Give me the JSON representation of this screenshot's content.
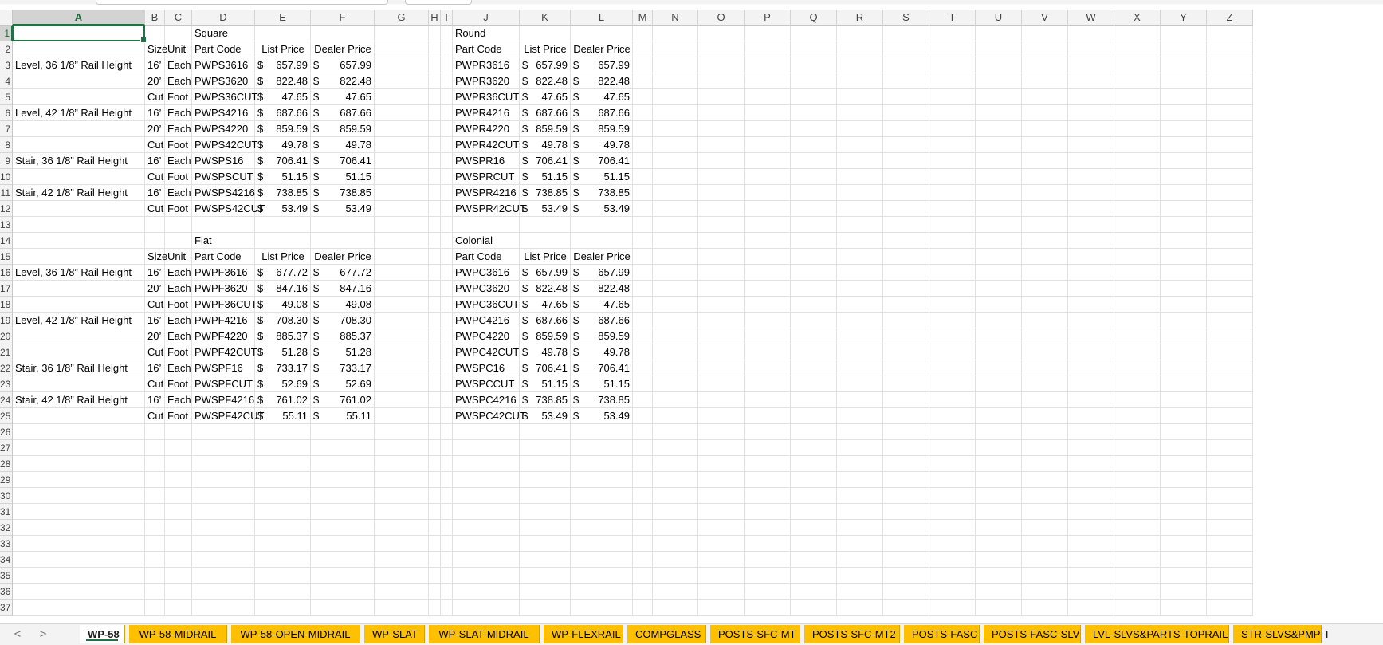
{
  "columns": [
    "A",
    "B",
    "C",
    "D",
    "E",
    "F",
    "G",
    "H",
    "I",
    "J",
    "K",
    "L",
    "M",
    "N",
    "O",
    "P",
    "Q",
    "R",
    "S",
    "T",
    "U",
    "V",
    "W",
    "X",
    "Y",
    "Z"
  ],
  "rows": [
    "1",
    "2",
    "3",
    "4",
    "5",
    "6",
    "7",
    "8",
    "9",
    "10",
    "11",
    "12",
    "13",
    "14",
    "15",
    "16",
    "17",
    "18",
    "19",
    "20",
    "21",
    "22",
    "23",
    "24",
    "25",
    "26",
    "27",
    "28",
    "29",
    "30",
    "31",
    "32",
    "33",
    "34",
    "35",
    "36",
    "37"
  ],
  "active_cell": "A1",
  "currency_symbol": "$",
  "tables": [
    {
      "section": "Square",
      "headers": {
        "size": "Size",
        "unit": "Unit",
        "part": "Part Code",
        "list": "List Price",
        "dealer": "Dealer Price"
      },
      "rows": [
        {
          "desc": "Level, 36 1/8” Rail Height",
          "size": "16’",
          "unit": "Each",
          "part": "PWPS3616",
          "list": "657.99",
          "dealer": "657.99"
        },
        {
          "desc": "",
          "size": "20’",
          "unit": "Each",
          "part": "PWPS3620",
          "list": "822.48",
          "dealer": "822.48"
        },
        {
          "desc": "",
          "size": "Cut",
          "unit": "Foot",
          "part": "PWPS36CUT",
          "list": "47.65",
          "dealer": "47.65"
        },
        {
          "desc": "Level, 42 1/8” Rail Height",
          "size": "16’",
          "unit": "Each",
          "part": "PWPS4216",
          "list": "687.66",
          "dealer": "687.66"
        },
        {
          "desc": "",
          "size": "20’",
          "unit": "Each",
          "part": "PWPS4220",
          "list": "859.59",
          "dealer": "859.59"
        },
        {
          "desc": "",
          "size": "Cut",
          "unit": "Foot",
          "part": "PWPS42CUT",
          "list": "49.78",
          "dealer": "49.78"
        },
        {
          "desc": "Stair, 36 1/8” Rail Height",
          "size": "16’",
          "unit": "Each",
          "part": "PWSPS16",
          "list": "706.41",
          "dealer": "706.41"
        },
        {
          "desc": "",
          "size": "Cut",
          "unit": "Foot",
          "part": "PWSPSCUT",
          "list": "51.15",
          "dealer": "51.15"
        },
        {
          "desc": "Stair, 42 1/8” Rail Height",
          "size": "16’",
          "unit": "Each",
          "part": "PWSPS4216",
          "list": "738.85",
          "dealer": "738.85"
        },
        {
          "desc": "",
          "size": "Cut",
          "unit": "Foot",
          "part": "PWSPS42CUT",
          "list": "53.49",
          "dealer": "53.49"
        }
      ]
    },
    {
      "section": "Round",
      "headers": {
        "part": "Part Code",
        "list": "List Price",
        "dealer": "Dealer Price"
      },
      "rows": [
        {
          "part": "PWPR3616",
          "list": "657.99",
          "dealer": "657.99"
        },
        {
          "part": "PWPR3620",
          "list": "822.48",
          "dealer": "822.48"
        },
        {
          "part": "PWPR36CUT",
          "list": "47.65",
          "dealer": "47.65"
        },
        {
          "part": "PWPR4216",
          "list": "687.66",
          "dealer": "687.66"
        },
        {
          "part": "PWPR4220",
          "list": "859.59",
          "dealer": "859.59"
        },
        {
          "part": "PWPR42CUT",
          "list": "49.78",
          "dealer": "49.78"
        },
        {
          "part": "PWSPR16",
          "list": "706.41",
          "dealer": "706.41"
        },
        {
          "part": "PWSPRCUT",
          "list": "51.15",
          "dealer": "51.15"
        },
        {
          "part": "PWSPR4216",
          "list": "738.85",
          "dealer": "738.85"
        },
        {
          "part": "PWSPR42CUT",
          "list": "53.49",
          "dealer": "53.49"
        }
      ]
    },
    {
      "section": "Flat",
      "headers": {
        "size": "Size",
        "unit": "Unit",
        "part": "Part Code",
        "list": "List Price",
        "dealer": "Dealer Price"
      },
      "rows": [
        {
          "desc": "Level, 36 1/8” Rail Height",
          "size": "16’",
          "unit": "Each",
          "part": "PWPF3616",
          "list": "677.72",
          "dealer": "677.72"
        },
        {
          "desc": "",
          "size": "20’",
          "unit": "Each",
          "part": "PWPF3620",
          "list": "847.16",
          "dealer": "847.16"
        },
        {
          "desc": "",
          "size": "Cut",
          "unit": "Foot",
          "part": "PWPF36CUT",
          "list": "49.08",
          "dealer": "49.08"
        },
        {
          "desc": "Level, 42 1/8” Rail Height",
          "size": "16’",
          "unit": "Each",
          "part": "PWPF4216",
          "list": "708.30",
          "dealer": "708.30"
        },
        {
          "desc": "",
          "size": "20’",
          "unit": "Each",
          "part": "PWPF4220",
          "list": "885.37",
          "dealer": "885.37"
        },
        {
          "desc": "",
          "size": "Cut",
          "unit": "Foot",
          "part": "PWPF42CUT",
          "list": "51.28",
          "dealer": "51.28"
        },
        {
          "desc": "Stair, 36 1/8” Rail Height",
          "size": "16’",
          "unit": "Each",
          "part": "PWSPF16",
          "list": "733.17",
          "dealer": "733.17"
        },
        {
          "desc": "",
          "size": "Cut",
          "unit": "Foot",
          "part": "PWSPFCUT",
          "list": "52.69",
          "dealer": "52.69"
        },
        {
          "desc": "Stair, 42 1/8” Rail Height",
          "size": "16’",
          "unit": "Each",
          "part": "PWSPF4216",
          "list": "761.02",
          "dealer": "761.02"
        },
        {
          "desc": "",
          "size": "Cut",
          "unit": "Foot",
          "part": "PWSPF42CUT",
          "list": "55.11",
          "dealer": "55.11"
        }
      ]
    },
    {
      "section": "Colonial",
      "headers": {
        "part": "Part Code",
        "list": "List Price",
        "dealer": "Dealer Price"
      },
      "rows": [
        {
          "part": "PWPC3616",
          "list": "657.99",
          "dealer": "657.99"
        },
        {
          "part": "PWPC3620",
          "list": "822.48",
          "dealer": "822.48"
        },
        {
          "part": "PWPC36CUT",
          "list": "47.65",
          "dealer": "47.65"
        },
        {
          "part": "PWPC4216",
          "list": "687.66",
          "dealer": "687.66"
        },
        {
          "part": "PWPC4220",
          "list": "859.59",
          "dealer": "859.59"
        },
        {
          "part": "PWPC42CUT",
          "list": "49.78",
          "dealer": "49.78"
        },
        {
          "part": "PWSPC16",
          "list": "706.41",
          "dealer": "706.41"
        },
        {
          "part": "PWSPCCUT",
          "list": "51.15",
          "dealer": "51.15"
        },
        {
          "part": "PWSPC4216",
          "list": "738.85",
          "dealer": "738.85"
        },
        {
          "part": "PWSPC42CUT",
          "list": "53.49",
          "dealer": "53.49"
        }
      ]
    }
  ],
  "sheet_tabs": {
    "nav_prev": "<",
    "nav_next": ">",
    "tabs": [
      "WP-58",
      "WP-58-MIDRAIL",
      "WP-58-OPEN-MIDRAIL",
      "WP-SLAT",
      "WP-SLAT-MIDRAIL",
      "WP-FLEXRAIL",
      "COMPGLASS",
      "POSTS-SFC-MT",
      "POSTS-SFC-MT2",
      "POSTS-FASC",
      "POSTS-FASC-SLV",
      "LVL-SLVS&PARTS-TOPRAIL",
      "STR-SLVS&PMP-T"
    ],
    "active": "WP-58",
    "tab_color": "#ffc000"
  },
  "colors": {
    "accent": "#217346",
    "header_bg": "#f3f3f3",
    "gridline": "#e1e1e1"
  }
}
